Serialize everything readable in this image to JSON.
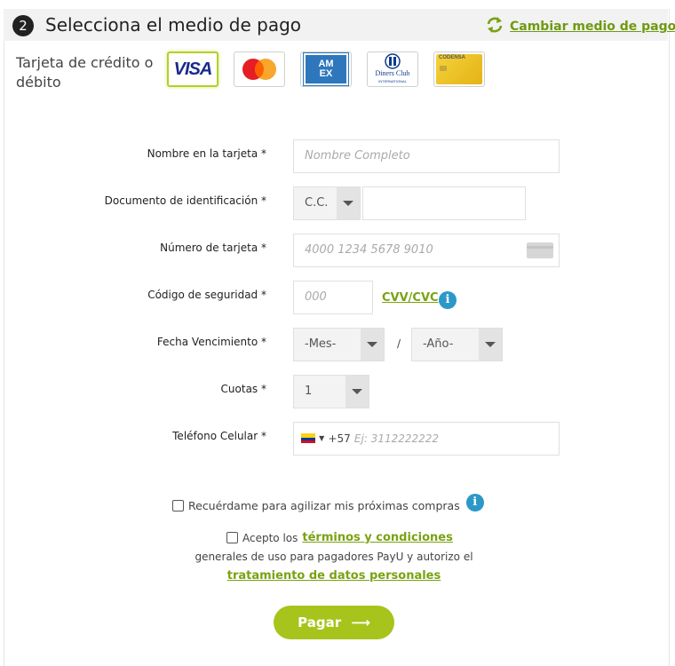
{
  "header": {
    "step_number": "2",
    "title": "Selecciona el medio de pago",
    "change_link": "Cambiar medio de pago"
  },
  "payment_method": {
    "label": "Tarjeta de crédito o débito",
    "cards": [
      {
        "name": "visa",
        "text": "VISA"
      },
      {
        "name": "mastercard",
        "text": ""
      },
      {
        "name": "amex",
        "text": "AM EX"
      },
      {
        "name": "diners",
        "text": "Diners Club",
        "subtext": "INTERNATIONAL"
      },
      {
        "name": "codensa",
        "text": "CODENSA"
      }
    ],
    "accent_color": "#b5cf2a"
  },
  "form": {
    "name_label": "Nombre en la tarjeta *",
    "name_placeholder": "Nombre Completo",
    "doc_label": "Documento de identificación *",
    "doc_type": "C.C.",
    "doc_value": "",
    "card_number_label": "Número de tarjeta *",
    "card_number_placeholder": "4000 1234 5678 9010",
    "cvv_label": "Código de seguridad *",
    "cvv_placeholder": "000",
    "cvv_link": "CVV/CVC",
    "expiry_label": "Fecha Vencimiento *",
    "expiry_month": "-Mes-",
    "expiry_separator": "/",
    "expiry_year": "-Año-",
    "installments_label": "Cuotas *",
    "installments_value": "1",
    "phone_label": "Teléfono Celular *",
    "phone_prefix": "+57",
    "phone_placeholder": "Ej: 3112222222"
  },
  "remember": {
    "label": "Recuérdame para agilizar mis próximas compras"
  },
  "terms": {
    "prefix": "Acepto los",
    "terms_link": "términos y condiciones",
    "middle": "generales de uso para pagadores PayU y autorizo el",
    "data_link": "tratamiento de datos personales"
  },
  "pay_button": {
    "label": "Pagar",
    "arrow": "⟶"
  },
  "colors": {
    "link_green": "#7aa212",
    "button_green": "#a6c41c",
    "info_blue": "#2c98c8"
  }
}
